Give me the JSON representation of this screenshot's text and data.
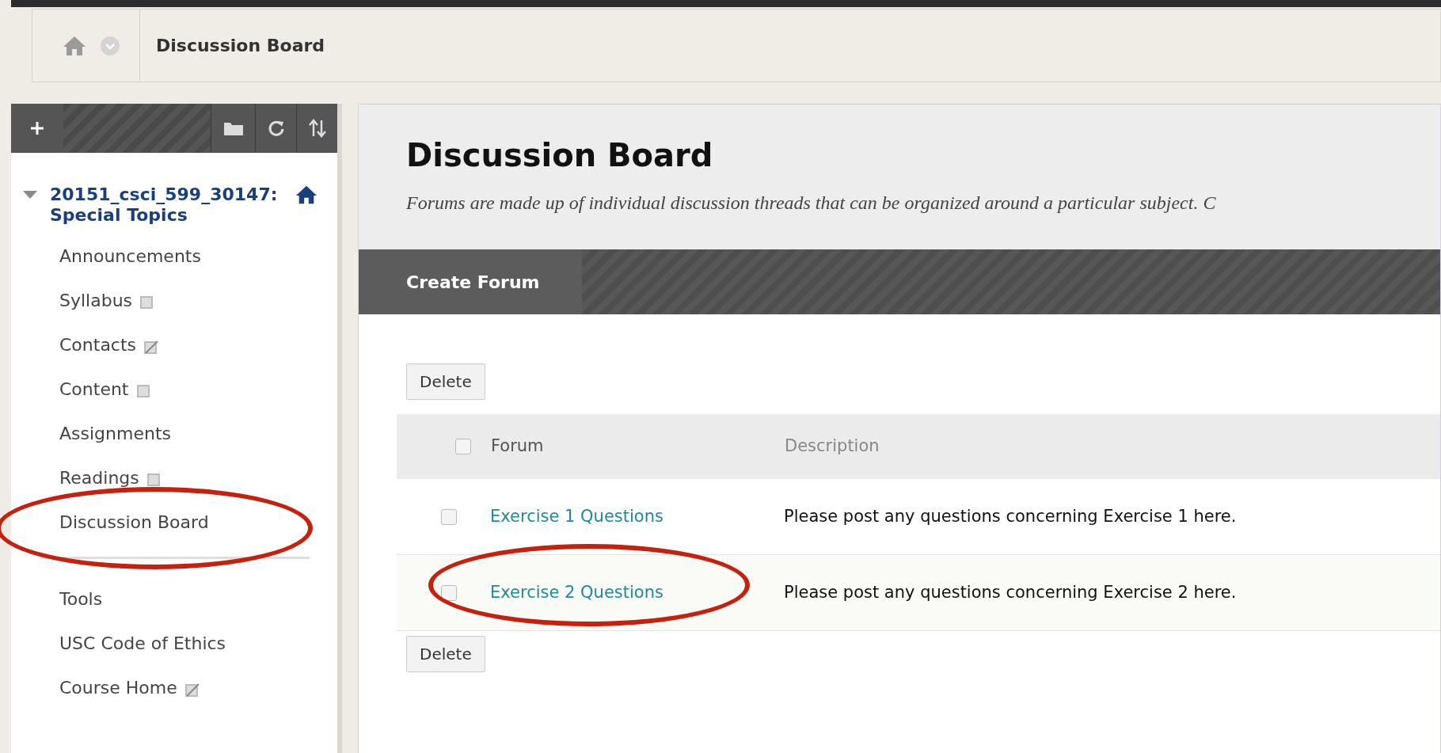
{
  "breadcrumb": {
    "current": "Discussion Board"
  },
  "course": {
    "title": "20151_csci_599_30147: Special Topics",
    "expanded": true
  },
  "menu": [
    {
      "label": "Announcements",
      "kind": "plain"
    },
    {
      "label": "Syllabus",
      "kind": "page"
    },
    {
      "label": "Contacts",
      "kind": "external"
    },
    {
      "label": "Content",
      "kind": "page"
    },
    {
      "label": "Assignments",
      "kind": "plain"
    },
    {
      "label": "Readings",
      "kind": "page"
    },
    {
      "label": "Discussion Board",
      "kind": "plain",
      "circled": true
    }
  ],
  "menu_tools": [
    {
      "label": "Tools",
      "kind": "plain"
    },
    {
      "label": "USC Code of Ethics",
      "kind": "plain"
    },
    {
      "label": "Course Home",
      "kind": "external"
    }
  ],
  "page": {
    "title": "Discussion Board",
    "description": "Forums are made up of individual discussion threads that can be organized around a particular subject. C",
    "action": "Create Forum"
  },
  "delete_button": "Delete",
  "table": {
    "columns": [
      "Forum",
      "Description"
    ],
    "select_all": {
      "checked": false
    },
    "rows": [
      {
        "forum": "Exercise 1 Questions",
        "description": "Please post any questions concerning Exercise 1 here.",
        "checked": false,
        "circled": false
      },
      {
        "forum": "Exercise 2 Questions",
        "description": "Please post any questions concerning Exercise 2 here.",
        "checked": false,
        "circled": true
      }
    ]
  },
  "bottom_delete_button": "Delete"
}
